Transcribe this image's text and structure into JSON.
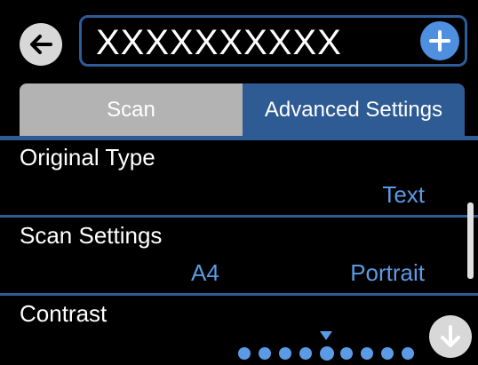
{
  "header": {
    "title": "XXXXXXXXXX",
    "back_icon": "arrow-left-icon",
    "add_icon": "plus-icon"
  },
  "tabs": [
    {
      "label": "Scan",
      "active": false
    },
    {
      "label": "Advanced Settings",
      "active": true
    }
  ],
  "settings": [
    {
      "label": "Original Type",
      "values": [
        "Text"
      ]
    },
    {
      "label": "Scan Settings",
      "values": [
        "A4",
        "Portrait"
      ]
    },
    {
      "label": "Contrast",
      "level": 5,
      "level_max": 9
    }
  ],
  "colors": {
    "accent": "#2e5b94",
    "value_text": "#5b9be6",
    "inactive_tab": "#b3b3b3",
    "add_button": "#4f8fe0"
  },
  "scroll_down_icon": "arrow-down-icon"
}
